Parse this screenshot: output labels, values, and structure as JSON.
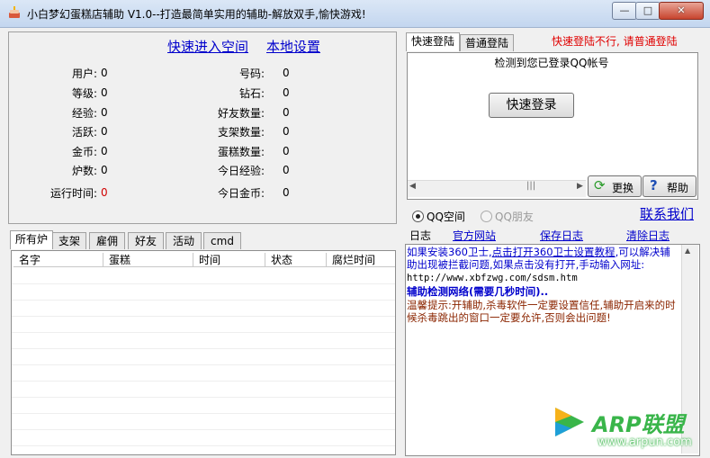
{
  "window": {
    "title": "小白梦幻蛋糕店辅助 V1.0--打造最简单实用的辅助-解放双手,愉快游戏!",
    "min_symbol": "—",
    "max_symbol": "□",
    "close_symbol": "✕"
  },
  "top_links": {
    "enter_space": "快速进入空间",
    "local_settings": "本地设置"
  },
  "stats_left": [
    {
      "label": "用户:",
      "value": "0"
    },
    {
      "label": "等级:",
      "value": "0"
    },
    {
      "label": "经验:",
      "value": "0"
    },
    {
      "label": "活跃:",
      "value": "0"
    },
    {
      "label": "金币:",
      "value": "0"
    },
    {
      "label": "炉数:",
      "value": "0"
    },
    {
      "label": "运行时间:",
      "value": "0"
    }
  ],
  "stats_right": [
    {
      "label": "号码:",
      "value": "0"
    },
    {
      "label": "钻石:",
      "value": "0"
    },
    {
      "label": "好友数量:",
      "value": "0"
    },
    {
      "label": "支架数量:",
      "value": "0"
    },
    {
      "label": "蛋糕数量:",
      "value": "0"
    },
    {
      "label": "今日经验:",
      "value": "0"
    },
    {
      "label": "今日金币:",
      "value": "0"
    }
  ],
  "list_tabs": [
    "所有炉",
    "支架",
    "雇佣",
    "好友",
    "活动",
    "cmd"
  ],
  "list_columns": [
    "名字",
    "蛋糕",
    "时间",
    "状态",
    "腐烂时间"
  ],
  "login": {
    "tab_quick": "快速登陆",
    "tab_normal": "普通登陆",
    "notice": "快速登陆不行, 请普通登陆",
    "detected": "检测到您已登录QQ帐号",
    "quick_login_button": "快速登录",
    "scroll_grip": "|||",
    "refresh_button": "更换",
    "help_button": "帮助"
  },
  "account_type": {
    "qq_space": "QQ空间",
    "qq_friend": "QQ朋友",
    "contact_us": "联系我们"
  },
  "log_bar": {
    "title": "日志",
    "official_site": "官方网站",
    "save_log": "保存日志",
    "clear_log": "清除日志"
  },
  "log_text": {
    "line1_a": "如果安装360卫士,",
    "line1_link": "点击打开360卫士设置教程",
    "line1_b": ",可以解决辅助出现被拦截问题,如果点击没有打开,手动输入网址:",
    "url": "http://www.xbfzwg.com/sdsm.htm",
    "detect": "辅助检测网络(需要几秒时间)..",
    "tip": "温馨提示:开辅助,杀毒软件一定要设置信任,辅助开启来的时候杀毒跳出的窗口一定要允许,否则会出问题!"
  },
  "watermark": {
    "brand": "ARP联盟",
    "site": "www.arpun.com"
  },
  "colors": {
    "link_blue": "#0000cc",
    "notice_red": "#e00000",
    "tip_brown": "#8b2500",
    "watermark_green": "#39b54a"
  }
}
